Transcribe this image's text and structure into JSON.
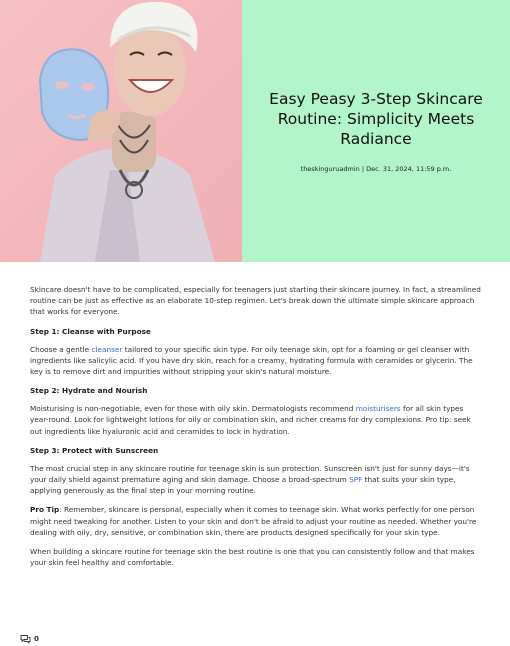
{
  "hero": {
    "title": "Easy Peasy 3-Step Skincare Routine: Simplicity Meets Radiance",
    "author": "theskinguruadmin",
    "separator": "|",
    "date": "Dec. 31, 2024, 11:59 p.m.",
    "panel_color": "#b2f5c8"
  },
  "article": {
    "intro": "Skincare doesn't have to be complicated, especially for teenagers just starting their skincare journey. In fact, a streamlined routine can be just as effective as an elaborate 10-step regimen. Let's break down the ultimate simple skincare approach that works for everyone.",
    "step1": {
      "heading": "Step 1: Cleanse with Purpose",
      "before": "Choose a gentle ",
      "link": "cleanser",
      "after": " tailored to your specific skin type. For oily teenage skin, opt for a foaming or gel cleanser with ingredients like salicylic acid. If you have dry skin, reach for a creamy, hydrating formula with ceramides or glycerin. The key is to remove dirt and impurities without stripping your skin's natural moisture."
    },
    "step2": {
      "heading": "Step 2: Hydrate and Nourish",
      "before": "Moisturising is non-negotiable, even for those with oily skin. Dermatologists recommend ",
      "link": "moisturisers",
      "after": " for all skin types year-round. Look for lightweight lotions for oily or combination skin, and richer creams for dry complexions. Pro tip: seek out ingredients like hyaluronic acid and ceramides to lock in hydration."
    },
    "step3": {
      "heading": "Step 3: Protect with Sunscreen",
      "before": "The most crucial step in any skincare routine for teenage skin is sun protection. Sunscreen isn't just for sunny days—it's your daily shield against premature aging and skin damage. Choose a broad-spectrum ",
      "link": "SPF",
      "after": " that suits your skin type, applying generously as the final step in your morning routine."
    },
    "protip": {
      "label": "Pro Tip",
      "text": ": Remember, skincare is personal, especially when it comes to teenage skin. What works perfectly for one person might need tweaking for another. Listen to your skin and don't be afraid to adjust your routine as needed. Whether you're dealing with oily, dry, sensitive, or combination skin, there are products designed specifically for your skin type."
    },
    "closing": "When building a skincare routine for teenage skin the best routine is one that you can consistently follow and that makes your skin feel healthy and comfortable.",
    "link_color": "#2f6fd0"
  },
  "footer": {
    "icon": "comment-icon",
    "comment_count": "0"
  }
}
